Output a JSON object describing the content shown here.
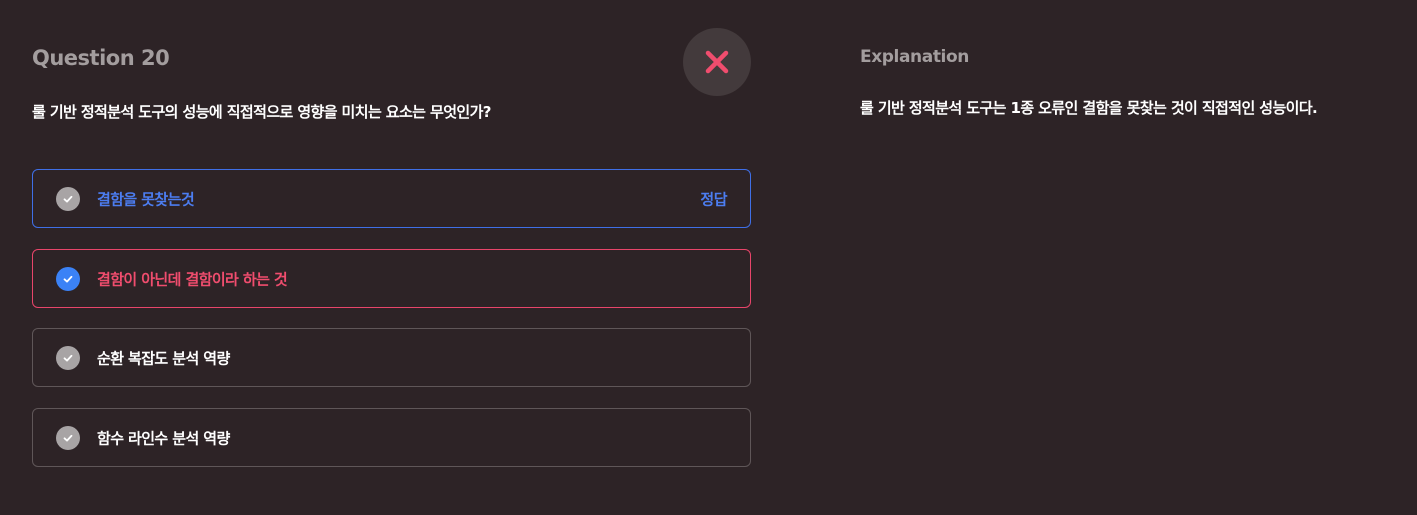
{
  "question": {
    "title": "Question 20",
    "text": "룰 기반 정적분석 도구의 성능에 직접적으로 영향을 미치는 요소는 무엇인가?",
    "result_icon": "close-icon",
    "result": "incorrect"
  },
  "options": [
    {
      "label": "결함을 못찾는것",
      "answer_tag": "정답",
      "state": "correct",
      "selected": false
    },
    {
      "label": "결함이 아닌데 결함이라 하는 것",
      "answer_tag": "",
      "state": "wrong",
      "selected": true
    },
    {
      "label": "순환 복잡도 분석 역량",
      "answer_tag": "",
      "state": "neutral",
      "selected": false
    },
    {
      "label": "함수 라인수 분석 역량",
      "answer_tag": "",
      "state": "neutral",
      "selected": false
    }
  ],
  "explanation": {
    "title": "Explanation",
    "text": "룰 기반 정적분석 도구는 1종 오류인 결함을 못찾는 것이 직접적인 성능이다."
  },
  "colors": {
    "background": "#2d2326",
    "correct": "#4c7df0",
    "wrong": "#f04d6e",
    "selected_check": "#3b82f6",
    "result_badge": "#433a3c"
  }
}
